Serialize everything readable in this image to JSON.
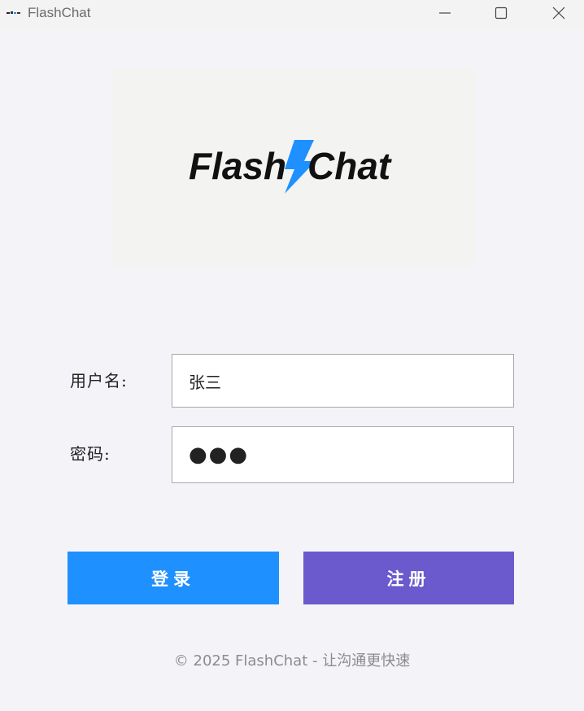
{
  "window": {
    "title": "FlashChat",
    "controls": {
      "minimize_icon": "minimize-icon",
      "maximize_icon": "maximize-icon",
      "close_icon": "close-icon"
    }
  },
  "logo": {
    "text_left": "Flash",
    "text_right": "Chat",
    "bolt_color": "#1e90ff",
    "text_color": "#111111"
  },
  "form": {
    "username_label": "用户名:",
    "username_value": "张三",
    "password_label": "密码:",
    "password_value": "●●●"
  },
  "buttons": {
    "login_label": "登录",
    "login_color": "#1e90ff",
    "register_label": "注册",
    "register_color": "#6a5acd"
  },
  "footer": {
    "text": "© 2025 FlashChat - 让沟通更快速"
  }
}
